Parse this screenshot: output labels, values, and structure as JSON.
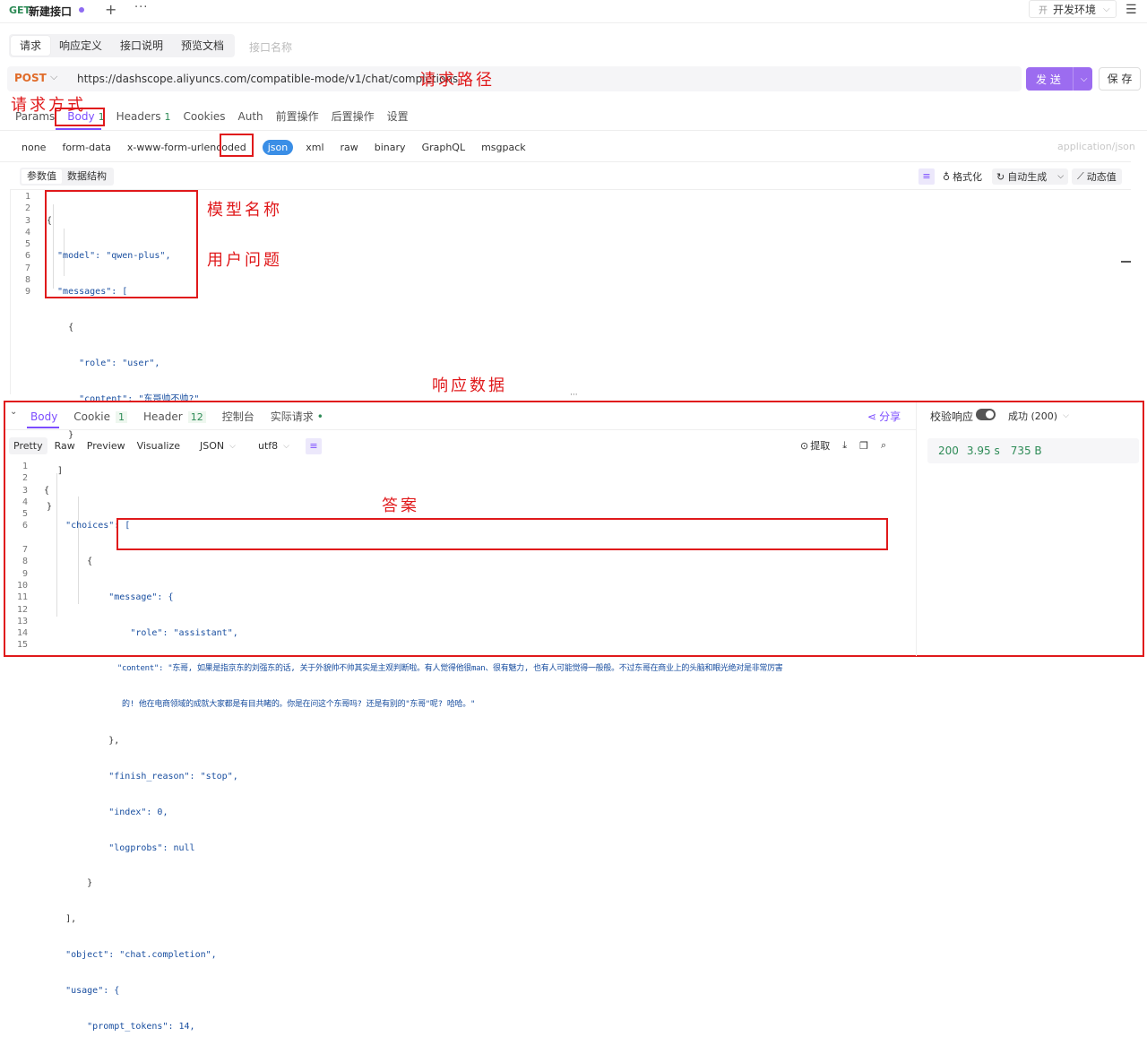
{
  "tab": {
    "method": "GET",
    "name": "新建接口",
    "plus": "+",
    "more": "···"
  },
  "env": {
    "icon": "开",
    "label": "开发环境",
    "chev": "⌵"
  },
  "menu_icon": "☰",
  "subtabs": [
    "请求",
    "响应定义",
    "接口说明",
    "预览文档"
  ],
  "api_name_placeholder": "接口名称",
  "request": {
    "method": "POST",
    "url": "https://dashscope.aliyuncs.com/compatible-mode/v1/chat/completions",
    "send_label": "发 送",
    "save_label": "保 存"
  },
  "req_tabs": [
    {
      "label": "Params"
    },
    {
      "label": "Body",
      "count": "1"
    },
    {
      "label": "Headers",
      "count": "1"
    },
    {
      "label": "Cookies"
    },
    {
      "label": "Auth"
    },
    {
      "label": "前置操作"
    },
    {
      "label": "后置操作"
    },
    {
      "label": "设置"
    }
  ],
  "body_types": [
    "none",
    "form-data",
    "x-www-form-urlencoded",
    "json",
    "xml",
    "raw",
    "binary",
    "GraphQL",
    "msgpack"
  ],
  "content_type": "application/json",
  "editor_tabs": [
    "参数值",
    "数据结构"
  ],
  "editor_actions": {
    "format": "格式化",
    "autogen": "自动生成",
    "dynamic": "动态值"
  },
  "request_code": [
    "{",
    "  \"model\": \"qwen-plus\",",
    "  \"messages\": [",
    "    {",
    "      \"role\": \"user\",",
    "      \"content\": \"东哥帅不帅?\"",
    "    }",
    "  ]",
    "}"
  ],
  "annotations": {
    "path": "请求路径",
    "method": "请求方式",
    "model": "模型名称",
    "question": "用户问题",
    "response": "响应数据",
    "answer": "答案"
  },
  "response": {
    "tabs": [
      {
        "label": "Body"
      },
      {
        "label": "Cookie",
        "count": "1"
      },
      {
        "label": "Header",
        "count": "12"
      },
      {
        "label": "控制台"
      },
      {
        "label": "实际请求"
      }
    ],
    "share": "分享",
    "verify": "校验响应",
    "status_select": "成功 (200)",
    "stats": {
      "code": "200",
      "time": "3.95 s",
      "size": "735 B"
    },
    "view_tabs": [
      "Pretty",
      "Raw",
      "Preview",
      "Visualize"
    ],
    "format": "JSON",
    "encoding": "utf8",
    "extract": "提取",
    "code": [
      "{",
      "    \"choices\": [",
      "        {",
      "            \"message\": {",
      "                \"role\": \"assistant\",",
      "                \"content\": \"东哥, 如果是指京东的刘强东的话, 关于外貌帅不帅其实是主观判断啦。有人觉得他很man、很有魅力, 也有人可能觉得一般般。不过东哥在商业上的头脑和眼光绝对是非常厉害",
      "的! 他在电商领域的成就大家都是有目共睹的。你是在问这个东哥吗? 还是有别的\"东哥\"呢? 哈哈。\"",
      "            },",
      "            \"finish_reason\": \"stop\",",
      "            \"index\": 0,",
      "            \"logprobs\": null",
      "        }",
      "    ],",
      "    \"object\": \"chat.completion\",",
      "    \"usage\": {",
      "        \"prompt_tokens\": 14,"
    ],
    "line_numbers": [
      "1",
      "2",
      "3",
      "4",
      "5",
      "6",
      "",
      "7",
      "8",
      "9",
      "10",
      "11",
      "12",
      "13",
      "14",
      "15"
    ]
  }
}
